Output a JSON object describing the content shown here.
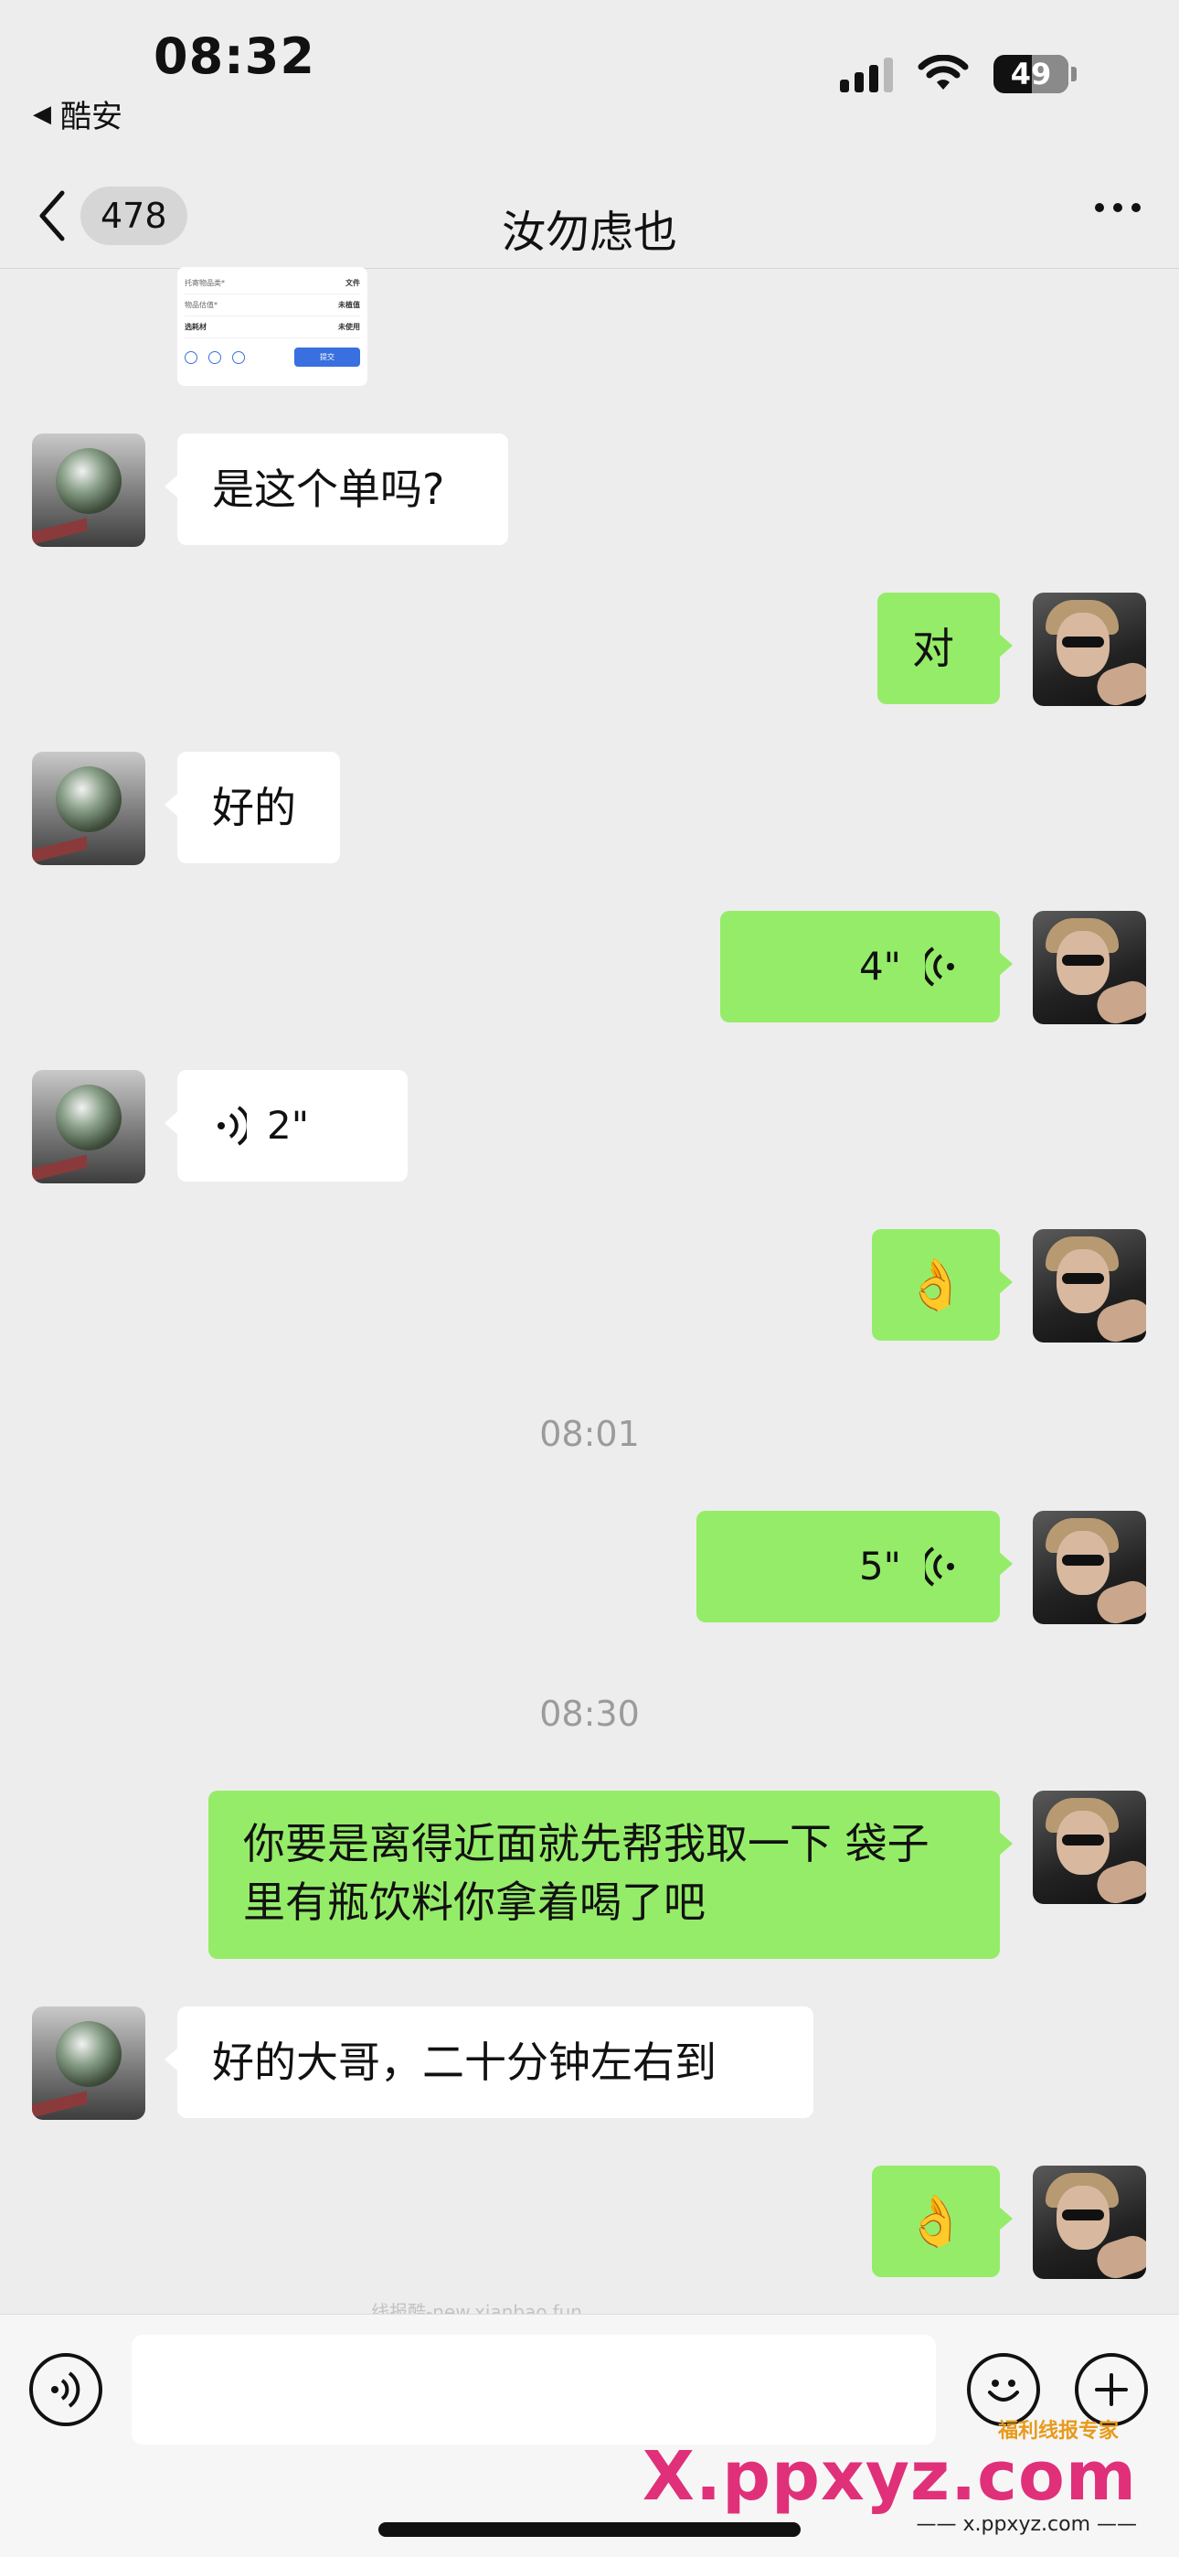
{
  "status_bar": {
    "time": "08:32",
    "back_app": "酷安",
    "battery": "49"
  },
  "nav": {
    "unread_count": "478",
    "title": "汝勿虑也"
  },
  "thumbnail": {
    "row1_label": "托寄物品类*",
    "row1_value": "文件",
    "row2_label": "物品估值*",
    "row2_value": "未植值",
    "row3_label": "选耗材",
    "row3_value": "未使用",
    "icon1": "附近",
    "icon2": "再来",
    "icon3": "转出",
    "submit": "提交"
  },
  "messages": [
    {
      "from": "other",
      "type": "text",
      "text": "是这个单吗?"
    },
    {
      "from": "me",
      "type": "text",
      "text": "对"
    },
    {
      "from": "other",
      "type": "text",
      "text": "好的"
    },
    {
      "from": "me",
      "type": "voice",
      "duration": "4\""
    },
    {
      "from": "other",
      "type": "voice",
      "duration": "2\""
    },
    {
      "from": "me",
      "type": "emoji",
      "text": "👌"
    },
    {
      "from": "me",
      "type": "voice",
      "duration": "5\""
    },
    {
      "from": "me",
      "type": "text",
      "text": "你要是离得近面就先帮我取一下 袋子里有瓶饮料你拿着喝了吧"
    },
    {
      "from": "other",
      "type": "text",
      "text": "好的大哥，二十分钟左右到"
    },
    {
      "from": "me",
      "type": "emoji",
      "text": "👌"
    }
  ],
  "timestamps": [
    "08:01",
    "08:30"
  ],
  "watermarks": {
    "small": "线报酷-new.xianbao.fun",
    "brand_tag": "福利线报专家",
    "brand_big": "X.ppxyz.com",
    "brand_sub": "—— x.ppxyz.com ——"
  }
}
